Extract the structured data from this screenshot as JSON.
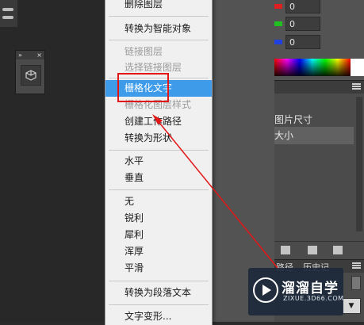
{
  "context_menu": {
    "items": [
      {
        "label": "删除图层",
        "state": "normal"
      },
      {
        "label": "转换为智能对象",
        "state": "normal"
      },
      {
        "label": "链接图层",
        "state": "disabled"
      },
      {
        "label": "选择链接图层",
        "state": "disabled"
      },
      {
        "label": "栅格化文字",
        "state": "highlighted"
      },
      {
        "label": "栅格化图层样式",
        "state": "disabled"
      },
      {
        "label": "创建工作路径",
        "state": "normal"
      },
      {
        "label": "转换为形状",
        "state": "normal"
      },
      {
        "label": "水平",
        "state": "normal"
      },
      {
        "label": "垂直",
        "state": "normal"
      },
      {
        "label": "无",
        "state": "normal"
      },
      {
        "label": "锐利",
        "state": "normal"
      },
      {
        "label": "犀利",
        "state": "normal"
      },
      {
        "label": "浑厚",
        "state": "normal"
      },
      {
        "label": "平滑",
        "state": "normal"
      },
      {
        "label": "转换为段落文本",
        "state": "normal"
      },
      {
        "label": "文字变形...",
        "state": "normal"
      }
    ]
  },
  "color_panel": {
    "values": [
      "0",
      "0",
      "0"
    ],
    "channel_colors": [
      "#e02020",
      "#20c020",
      "#2040e0"
    ]
  },
  "props_panel": {
    "rows": [
      "图片尺寸",
      "大小"
    ]
  },
  "bottom_tabs": {
    "paths": "路径",
    "history": "历史记"
  },
  "watermark": {
    "title": "溜溜自学",
    "subtitle": "ZIXUE.3D66.COM"
  },
  "colors": {
    "menu_bg": "#f0f0f0",
    "highlight": "#3d9be9",
    "annotation": "#e21616",
    "panel_bg": "#535353"
  }
}
